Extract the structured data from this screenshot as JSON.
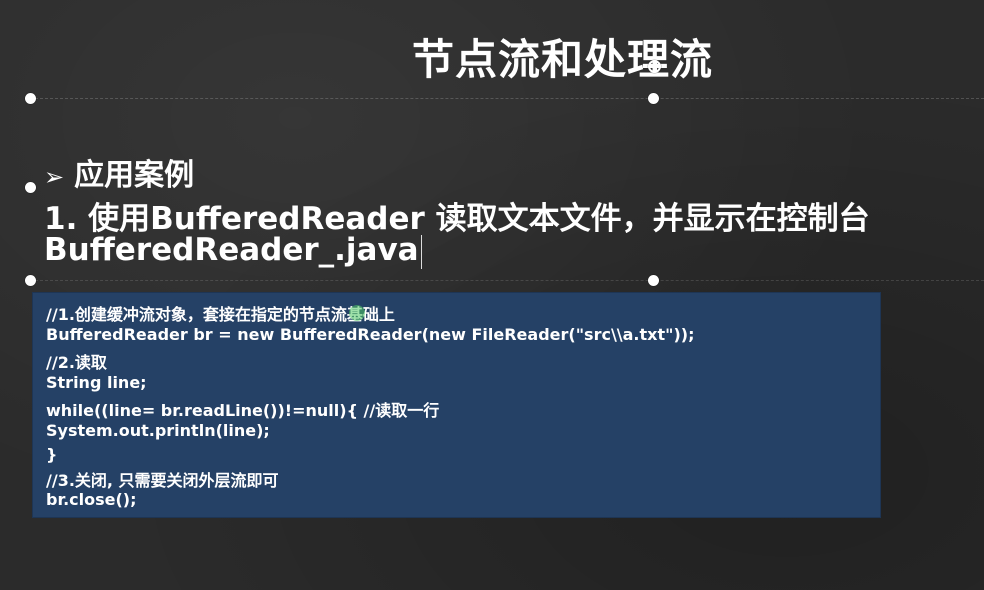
{
  "slide": {
    "title": "节点流和处理流",
    "bullet_arrow": "➢",
    "bullet": "应用案例",
    "line1": "1. 使用BufferedReader 读取文本文件，并显示在控制台",
    "line2": "BufferedReader_.java"
  },
  "code": {
    "lines": [
      "//1.创建缓冲流对象，套接在指定的节点流基础上",
      "BufferedReader br = new BufferedReader(new FileReader(\"src\\\\a.txt\"));",
      "//2.读取",
      "String line;",
      "while((line= br.readLine())!=null){ //读取一行",
      "System.out.println(line);",
      "}",
      "//3.关闭, 只需要关闭外层流即可",
      "br.close();"
    ]
  },
  "colors": {
    "background": "#2b2b2b",
    "code_background": "#254166",
    "text": "#ffffff"
  }
}
